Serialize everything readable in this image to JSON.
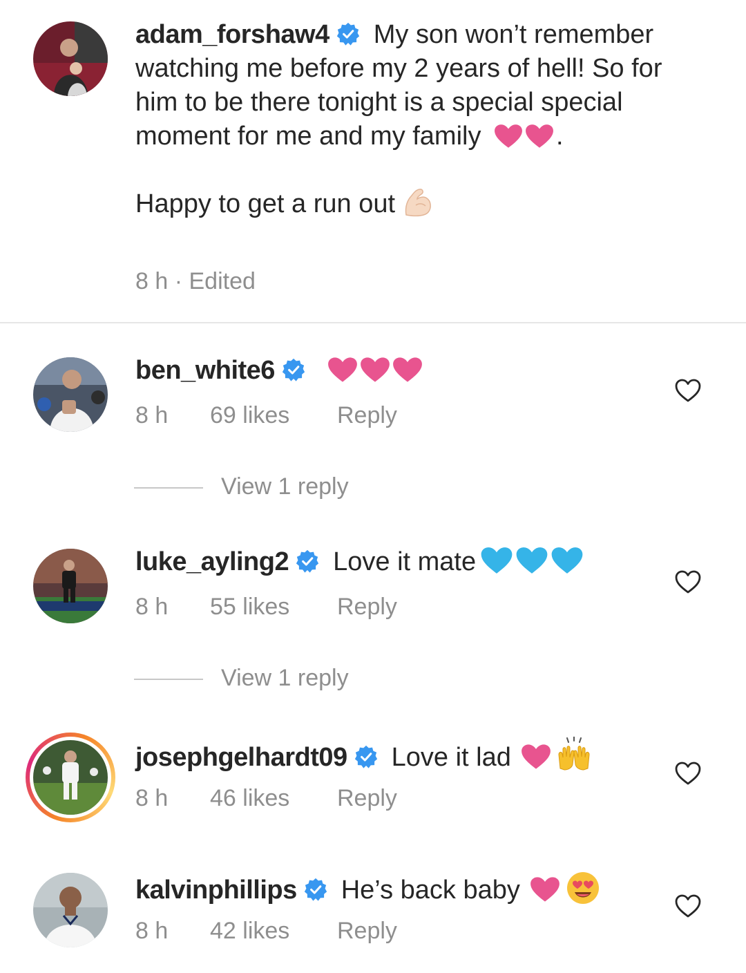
{
  "caption": {
    "username": "adam_forshaw4",
    "text_part1": "My son won’t remember watching me before my 2 years of hell! So for him to be there tonight is a special special moment for me and my family",
    "text_part1_end": ".",
    "text_part2": "Happy to get a run out",
    "time": "8 h",
    "edited": "· Edited"
  },
  "comments": [
    {
      "username": "ben_white6",
      "text": "",
      "time": "8 h",
      "likes": "69 likes",
      "reply": "Reply",
      "view_replies": "View 1 reply"
    },
    {
      "username": "luke_ayling2",
      "text": "Love it mate",
      "time": "8 h",
      "likes": "55 likes",
      "reply": "Reply",
      "view_replies": "View 1 reply"
    },
    {
      "username": "josephgelhardt09",
      "text": "Love it lad",
      "time": "8 h",
      "likes": "46 likes",
      "reply": "Reply"
    },
    {
      "username": "kalvinphillips",
      "text": "He’s back baby",
      "time": "8 h",
      "likes": "42 likes",
      "reply": "Reply"
    }
  ],
  "icons": {
    "verified": "verified-badge-icon",
    "like": "heart-outline-icon",
    "pink_heart": "pink-heart-emoji",
    "blue_heart": "blue-heart-emoji",
    "flexed_bicep": "flexed-bicep-emoji",
    "raising_hands": "raising-hands-emoji",
    "heart_eyes": "heart-eyes-emoji"
  },
  "colors": {
    "verified_blue": "#3897f0",
    "pink_heart": "#e8548f",
    "blue_heart": "#35b4e8",
    "text_primary": "#262626",
    "text_secondary": "#8e8e8e"
  }
}
